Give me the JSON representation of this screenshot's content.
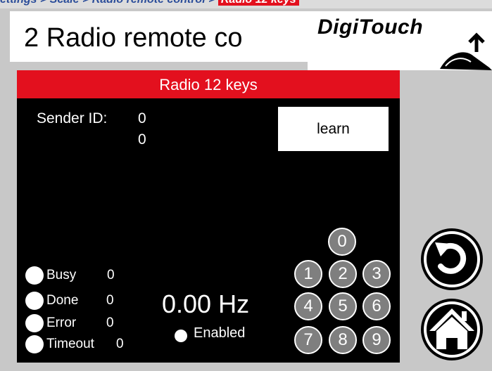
{
  "breadcrumb": {
    "path": "ettings > Scale > Radio remote control > ",
    "current": "Radio 12 keys"
  },
  "header": {
    "title": "2 Radio remote co",
    "logo_text": "DigiTouch"
  },
  "panel": {
    "title": "Radio 12 keys",
    "sender_label": "Sender ID:",
    "sender_id_1": "0",
    "sender_id_2": "0",
    "learn_label": "learn",
    "frequency": "0.00 Hz",
    "enabled_label": "Enabled",
    "status": [
      {
        "label": "Busy",
        "value": "0"
      },
      {
        "label": "Done",
        "value": "0"
      },
      {
        "label": "Error",
        "value": "0"
      },
      {
        "label": "Timeout",
        "value": "0"
      }
    ],
    "keys": [
      "0",
      "1",
      "2",
      "3",
      "4",
      "5",
      "6",
      "7",
      "8",
      "9"
    ]
  },
  "side": {
    "back_icon": "undo-arrow-icon",
    "home_icon": "home-icon"
  },
  "colors": {
    "accent_red": "#e3101e",
    "panel_bg": "#000000",
    "key_gray": "#7f7f7f",
    "crumb_blue": "#2b4d9a"
  }
}
